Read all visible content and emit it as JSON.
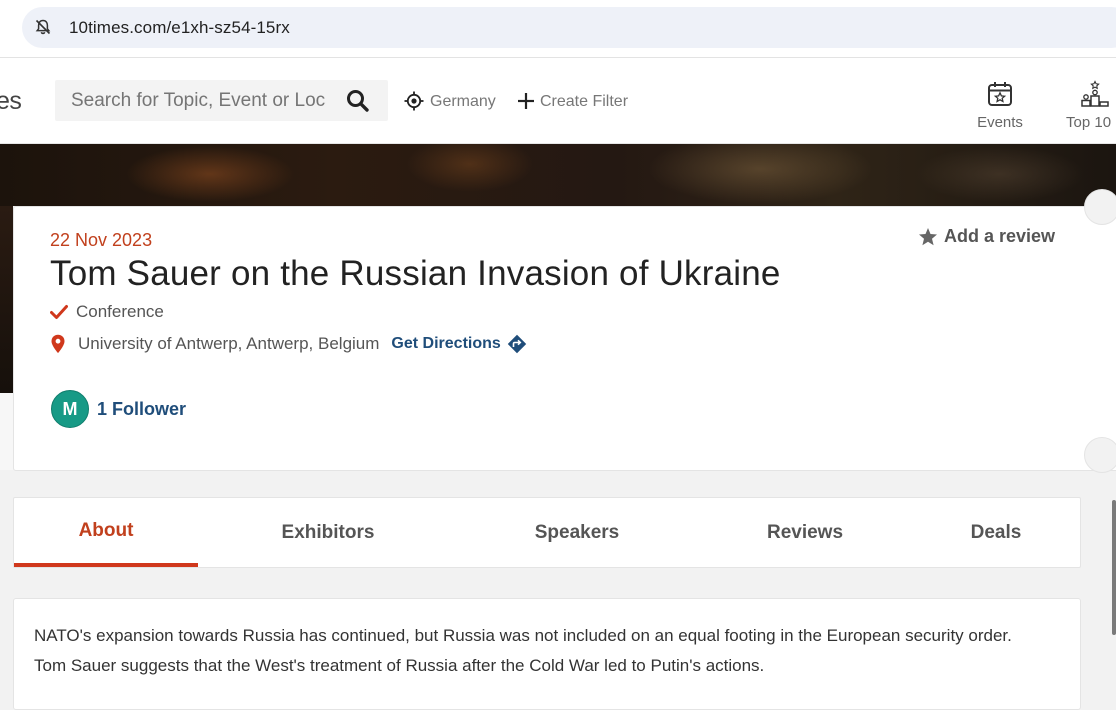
{
  "browser": {
    "url": "10times.com/e1xh-sz54-15rx"
  },
  "header": {
    "logo_fragment": "es",
    "search_placeholder": "Search for Topic, Event or Location",
    "location_label": "Germany",
    "create_filter_label": "Create Filter",
    "nav": [
      {
        "label": "Events",
        "icon": "calendar-star-icon"
      },
      {
        "label": "Top 10",
        "icon": "podium-icon"
      }
    ]
  },
  "event": {
    "date": "22 Nov 2023",
    "title": "Tom Sauer on the Russian Invasion of Ukraine",
    "type": "Conference",
    "location": "University of Antwerp, Antwerp, Belgium",
    "directions_label": "Get Directions",
    "review_label": "Add a review",
    "follower_initial": "M",
    "followers_label": "1 Follower"
  },
  "tabs": [
    {
      "label": "About",
      "active": true
    },
    {
      "label": "Exhibitors",
      "active": false
    },
    {
      "label": "Speakers",
      "active": false
    },
    {
      "label": "Reviews",
      "active": false
    },
    {
      "label": "Deals",
      "active": false
    }
  ],
  "about": {
    "line1": "NATO's expansion towards Russia has continued, but Russia was not included on an equal footing in the European security order.",
    "line2": "Tom Sauer suggests that the West's treatment of Russia after the Cold War led to Putin's actions."
  },
  "colors": {
    "accent": "#c1401d",
    "link": "#1f4d7a",
    "avatar": "#179a86"
  }
}
